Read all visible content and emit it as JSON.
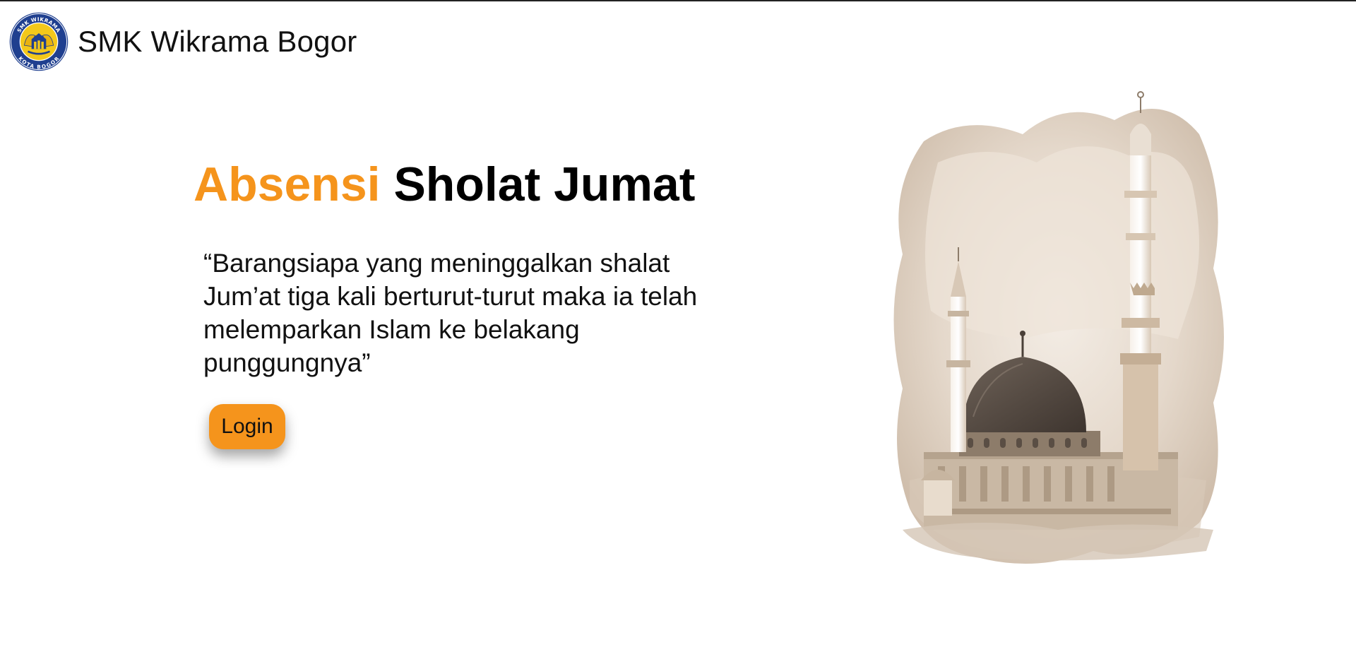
{
  "header": {
    "brand_name": "SMK Wikrama Bogor",
    "logo": {
      "icon": "school-emblem-icon",
      "ring_text_top": "SMK WIKRAMA",
      "ring_text_bottom": "KOTA BOGOR"
    }
  },
  "hero": {
    "title_accent": "Absensi",
    "title_rest": "Sholat Jumat",
    "quote": "“Barangsiapa yang meninggalkan shalat Jum’at tiga kali berturut-turut maka ia telah melemparkan Islam ke belakang punggungnya”",
    "login_label": "Login"
  },
  "illustration": {
    "icon": "mosque-watercolor-icon"
  },
  "colors": {
    "accent": "#f5941c",
    "logo_blue": "#1f3f8f",
    "logo_yellow": "#f3c81a",
    "sepia": "#8a7560"
  }
}
